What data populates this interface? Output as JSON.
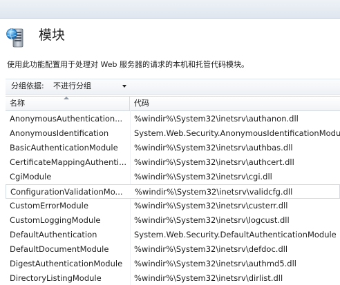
{
  "page": {
    "title": "模块",
    "description": "使用此功能配置用于处理对 Web 服务器的请求的本机和托管代码模块。"
  },
  "icons": {
    "header": "server-modules-icon"
  },
  "toolbar": {
    "group_label": "分组依据:",
    "group_value": "不进行分组"
  },
  "table": {
    "columns": [
      "名称",
      "代码"
    ],
    "rows": [
      {
        "name": "AnonymousAuthentication...",
        "code": "%windir%\\System32\\inetsrv\\authanon.dll"
      },
      {
        "name": "AnonymousIdentification",
        "code": "System.Web.Security.AnonymousIdentificationModu"
      },
      {
        "name": "BasicAuthenticationModule",
        "code": "%windir%\\System32\\inetsrv\\authbas.dll"
      },
      {
        "name": "CertificateMappingAuthenti...",
        "code": "%windir%\\System32\\inetsrv\\authcert.dll"
      },
      {
        "name": "CgiModule",
        "code": "%windir%\\System32\\inetsrv\\cgi.dll"
      },
      {
        "name": "ConfigurationValidationMo...",
        "code": "%windir%\\System32\\inetsrv\\validcfg.dll"
      },
      {
        "name": "CustomErrorModule",
        "code": "%windir%\\System32\\inetsrv\\custerr.dll"
      },
      {
        "name": "CustomLoggingModule",
        "code": "%windir%\\System32\\inetsrv\\logcust.dll"
      },
      {
        "name": "DefaultAuthentication",
        "code": "System.Web.Security.DefaultAuthenticationModule"
      },
      {
        "name": "DefaultDocumentModule",
        "code": "%windir%\\System32\\inetsrv\\defdoc.dll"
      },
      {
        "name": "DigestAuthenticationModule",
        "code": "%windir%\\System32\\inetsrv\\authmd5.dll"
      },
      {
        "name": "DirectoryListingModule",
        "code": "%windir%\\System32\\inetsrv\\dirlist.dll"
      }
    ],
    "selected_row": 5
  }
}
